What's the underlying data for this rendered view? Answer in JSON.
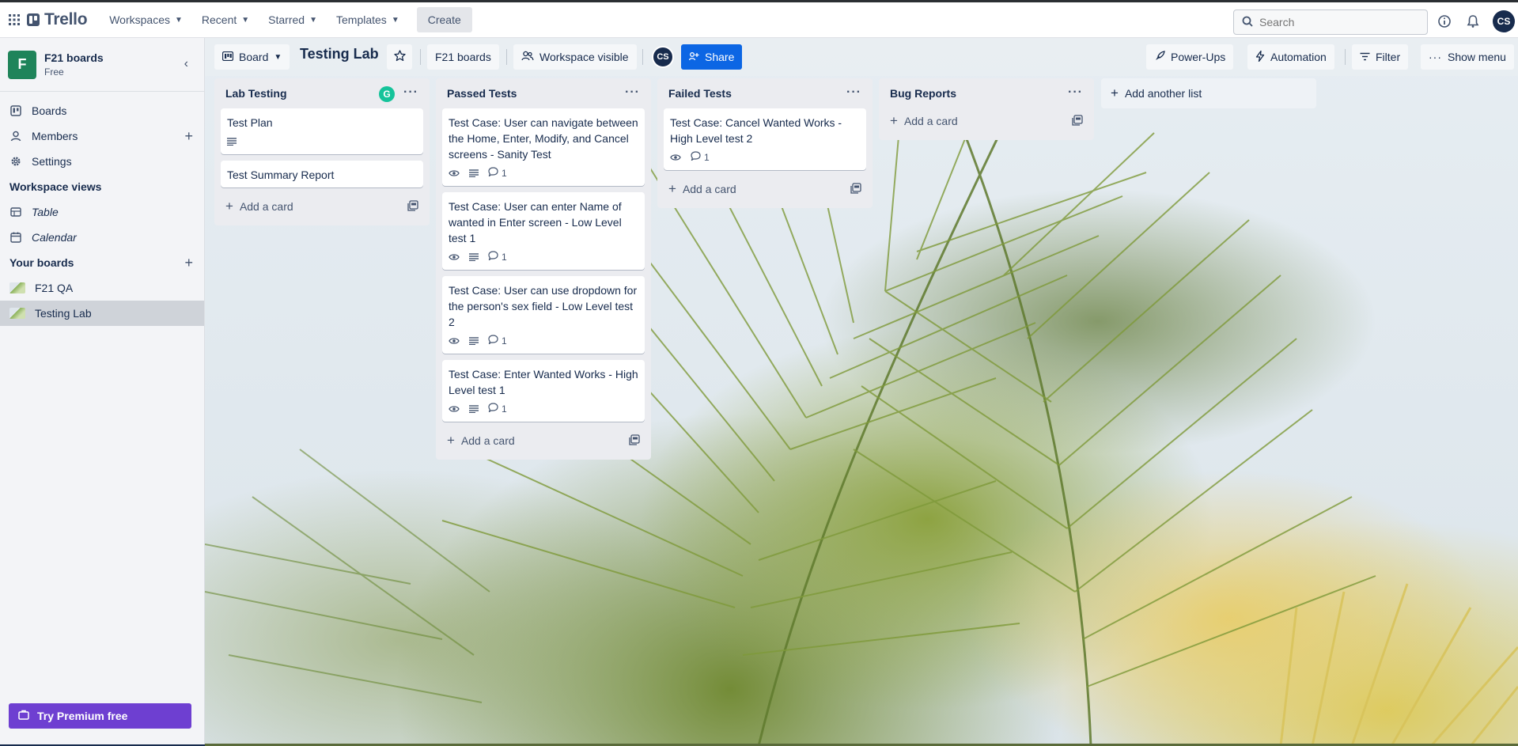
{
  "topbar": {
    "brand": "Trello",
    "nav": [
      {
        "label": "Workspaces"
      },
      {
        "label": "Recent"
      },
      {
        "label": "Starred"
      },
      {
        "label": "Templates"
      }
    ],
    "create_label": "Create",
    "search_placeholder": "Search",
    "user_initials": "CS"
  },
  "sidebar": {
    "workspace_initial": "F",
    "workspace_name": "F21 boards",
    "workspace_plan": "Free",
    "items": [
      {
        "label": "Boards",
        "icon": "board-icon"
      },
      {
        "label": "Members",
        "icon": "person-icon"
      },
      {
        "label": "Settings",
        "icon": "gear-icon"
      }
    ],
    "views_title": "Workspace views",
    "views": [
      {
        "label": "Table",
        "icon": "table-icon"
      },
      {
        "label": "Calendar",
        "icon": "calendar-icon"
      }
    ],
    "boards_title": "Your boards",
    "boards": [
      {
        "label": "F21 QA",
        "active": false
      },
      {
        "label": "Testing Lab",
        "active": true
      }
    ],
    "premium_label": "Try Premium free"
  },
  "board": {
    "view_label": "Board",
    "title": "Testing Lab",
    "workspace_label": "F21 boards",
    "visibility_label": "Workspace visible",
    "member_initials": "CS",
    "share_label": "Share",
    "powerups_label": "Power-Ups",
    "automation_label": "Automation",
    "filter_label": "Filter",
    "show_menu_label": "Show menu",
    "add_list_label": "Add another list",
    "add_card_label": "Add a card"
  },
  "lists": [
    {
      "title": "Lab Testing",
      "cards": [
        {
          "title": "Test Plan",
          "has_description": true,
          "watching": false,
          "comments": null
        },
        {
          "title": "Test Summary Report",
          "has_description": false,
          "watching": false,
          "comments": null
        }
      ]
    },
    {
      "title": "Passed Tests",
      "cards": [
        {
          "title": "Test Case: User can navigate between the Home, Enter, Modify, and Cancel screens - Sanity Test",
          "has_description": true,
          "watching": true,
          "comments": "1"
        },
        {
          "title": "Test Case: User can enter Name of wanted in Enter screen - Low Level test 1",
          "has_description": true,
          "watching": true,
          "comments": "1"
        },
        {
          "title": "Test Case: User can use dropdown for the person's sex field - Low Level test 2",
          "has_description": true,
          "watching": true,
          "comments": "1"
        },
        {
          "title": "Test Case: Enter Wanted Works - High Level test 1",
          "has_description": true,
          "watching": true,
          "comments": "1"
        }
      ]
    },
    {
      "title": "Failed Tests",
      "cards": [
        {
          "title": "Test Case: Cancel Wanted Works - High Level test 2",
          "has_description": false,
          "watching": true,
          "comments": "1"
        }
      ]
    },
    {
      "title": "Bug Reports",
      "cards": []
    }
  ],
  "colors": {
    "share": "#0c66e4",
    "premium": "#6e3fd1",
    "workspace_tile": "#1f845a"
  }
}
